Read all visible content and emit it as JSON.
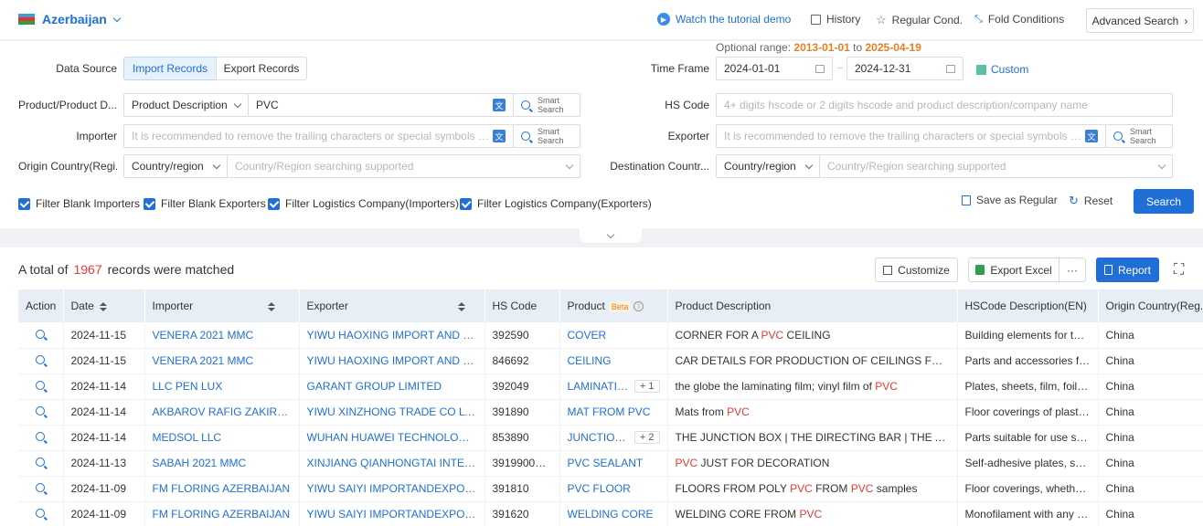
{
  "header": {
    "country": "Azerbaijan",
    "watch_tutorial": "Watch the tutorial demo",
    "history": "History",
    "regular_cond": "Regular Cond.",
    "fold_conditions": "Fold Conditions",
    "advanced_search": "Advanced Search"
  },
  "filters": {
    "data_source_label": "Data Source",
    "import_records": "Import Records",
    "export_records": "Export Records",
    "optional_range_label": "Optional range",
    "optional_range_start": "2013-01-01",
    "optional_range_to": "to",
    "optional_range_end": "2025-04-19",
    "time_frame_label": "Time Frame",
    "date_from": "2024-01-01",
    "date_to": "2024-12-31",
    "custom": "Custom",
    "product_label": "Product/Product D...",
    "product_type": "Product Description",
    "product_value": "PVC",
    "smart_search_1": "Smart",
    "smart_search_2": "Search",
    "hs_code_label": "HS Code",
    "hs_code_placeholder": "4+ digits hscode or 2 digits hscode and product description/company name",
    "importer_label": "Importer",
    "importer_placeholder": "It is recommended to remove the trailing characters or special symbols of the...",
    "exporter_label": "Exporter",
    "exporter_placeholder": "It is recommended to remove the trailing characters or special symbols of the...",
    "origin_label": "Origin Country(Regi...",
    "origin_type": "Country/region",
    "origin_placeholder": "Country/Region searching supported",
    "destination_label": "Destination Countr...",
    "destination_type": "Country/region",
    "destination_placeholder": "Country/Region searching supported",
    "checkboxes": [
      "Filter Blank Importers",
      "Filter Blank Exporters",
      "Filter Logistics Company(Importers)",
      "Filter Logistics Company(Exporters)"
    ],
    "save_regular": "Save as Regular",
    "reset": "Reset",
    "search": "Search"
  },
  "results": {
    "total_prefix": "A total of",
    "total_count": "1967",
    "total_suffix": "records were matched",
    "customize": "Customize",
    "export_excel": "Export Excel",
    "more": "···",
    "report": "Report",
    "columns": [
      "Action",
      "Date",
      "Importer",
      "Exporter",
      "HS Code",
      "Product",
      "Product Description",
      "HSCode Description(EN)",
      "Origin Country(Reg..."
    ],
    "beta": "Beta",
    "rows": [
      {
        "date": "2024-11-15",
        "importer": "VENERA 2021 MMC",
        "exporter": "YIWU HAOXING IMPORT AND EXP...",
        "hs": "392590",
        "product": "COVER",
        "plus": "",
        "desc_parts": [
          "CORNER FOR A ",
          "PVC",
          " CEILING"
        ],
        "hsdesc": "Building elements for the ...",
        "origin": "China"
      },
      {
        "date": "2024-11-15",
        "importer": "VENERA 2021 MMC",
        "exporter": "YIWU HAOXING IMPORT AND EXP...",
        "hs": "846692",
        "product": "CEILING",
        "plus": "",
        "desc_parts": [
          "CAR DETAILS FOR PRODUCTION OF CEILINGS FROM ",
          "PVC",
          ""
        ],
        "hsdesc": "Parts and accessories for ...",
        "origin": "China"
      },
      {
        "date": "2024-11-14",
        "importer": "LLC PEN LUX",
        "exporter": "GARANT GROUP LIMITED",
        "hs": "392049",
        "product": "LAMINATIN...",
        "plus": "+ 1",
        "desc_parts": [
          "the globe the laminating film; vinyl film of ",
          "PVC",
          ""
        ],
        "hsdesc": "Plates, sheets, film, foil an...",
        "origin": "China"
      },
      {
        "date": "2024-11-14",
        "importer": "AKBAROV RAFIG ZAKIR OGLU",
        "exporter": "YIWU XINZHONG TRADE CO LTD",
        "hs": "391890",
        "product": "MAT FROM PVC",
        "plus": "",
        "desc_parts": [
          "Mats from ",
          "PVC",
          ""
        ],
        "hsdesc": "Floor coverings of plastic...",
        "origin": "China"
      },
      {
        "date": "2024-11-14",
        "importer": "MEDSOL LLC",
        "exporter": "WUHAN HUAWEI TECHNOLOGY CO...",
        "hs": "853890",
        "product": "JUNCTION B...",
        "plus": "+ 2",
        "desc_parts": [
          "THE JUNCTION BOX | THE DIRECTING BAR | THE AIR DUC...",
          "",
          ""
        ],
        "hsdesc": "Parts suitable for use sole...",
        "origin": "China"
      },
      {
        "date": "2024-11-13",
        "importer": "SABAH 2021 MMC",
        "exporter": "XINJIANG QIANHONGTAI INTERNA...",
        "hs": "3919900000",
        "product": "PVC SEALANT",
        "plus": "",
        "desc_parts": [
          "",
          "PVC",
          " JUST FOR DECORATION"
        ],
        "hsdesc": "Self-adhesive plates, she...",
        "origin": "China"
      },
      {
        "date": "2024-11-09",
        "importer": "FM FLORING AZERBAIJAN",
        "exporter": "YIWU SAIYI IMPORTANDEXPORT C...",
        "hs": "391810",
        "product": "PVC FLOOR",
        "plus": "",
        "desc_parts": [
          "FLOORS FROM POLY ",
          "PVC",
          " FROM ",
          "PVC",
          " samples"
        ],
        "hsdesc": "Floor coverings, whether ...",
        "origin": "China"
      },
      {
        "date": "2024-11-09",
        "importer": "FM FLORING AZERBAIJAN",
        "exporter": "YIWU SAIYI IMPORTANDEXPORT C...",
        "hs": "391620",
        "product": "WELDING CORE",
        "plus": "",
        "desc_parts": [
          "WELDING CORE FROM ",
          "PVC",
          ""
        ],
        "hsdesc": "Monofilament with any cr...",
        "origin": "China"
      }
    ]
  }
}
